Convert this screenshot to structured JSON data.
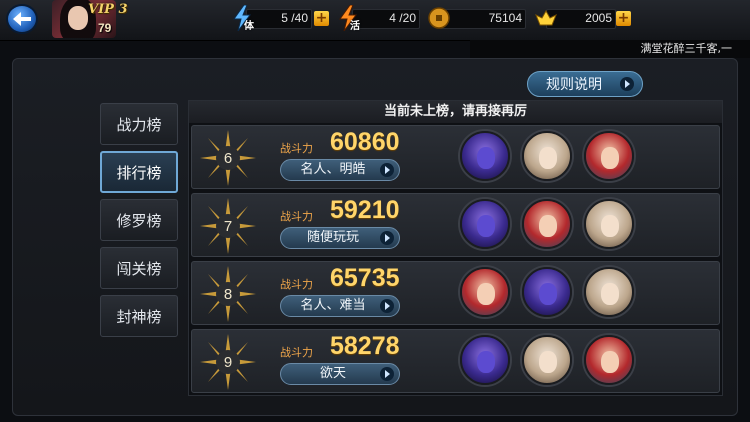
{
  "player": {
    "vip": "VIP 3",
    "level": "79"
  },
  "resources": {
    "stamina": {
      "label": "体",
      "value": "5 /40",
      "icon": "lightning-icon"
    },
    "energy": {
      "label": "活",
      "value": "4 /20",
      "icon": "flame-icon"
    },
    "coins": {
      "value": "75104",
      "icon": "coin-icon"
    },
    "ingots": {
      "value": "2005",
      "icon": "gold-ingot-icon"
    }
  },
  "marquee": "满堂花醉三千客,一",
  "rules_button": "规则说明",
  "tabs": [
    {
      "label": "战力榜",
      "active": false
    },
    {
      "label": "排行榜",
      "active": true
    },
    {
      "label": "修罗榜",
      "active": false
    },
    {
      "label": "闯关榜",
      "active": false
    },
    {
      "label": "封神榜",
      "active": false
    }
  ],
  "notice": "当前未上榜，请再接再厉",
  "power_label": "战斗力",
  "rows": [
    {
      "rank": "6",
      "power": "60860",
      "name": "名人、明皓",
      "heroes": [
        "blue",
        "pale",
        "red"
      ]
    },
    {
      "rank": "7",
      "power": "59210",
      "name": "随便玩玩",
      "heroes": [
        "blue",
        "red",
        "pale"
      ]
    },
    {
      "rank": "8",
      "power": "65735",
      "name": "名人、难当",
      "heroes": [
        "red",
        "blue",
        "pale"
      ]
    },
    {
      "rank": "9",
      "power": "58278",
      "name": "欲天",
      "heroes": [
        "blue",
        "pale",
        "red"
      ]
    }
  ],
  "colors": {
    "accent_gold": "#ffd56a",
    "power_label": "#f0a64a",
    "active_tab_border": "#6fa8d6"
  }
}
